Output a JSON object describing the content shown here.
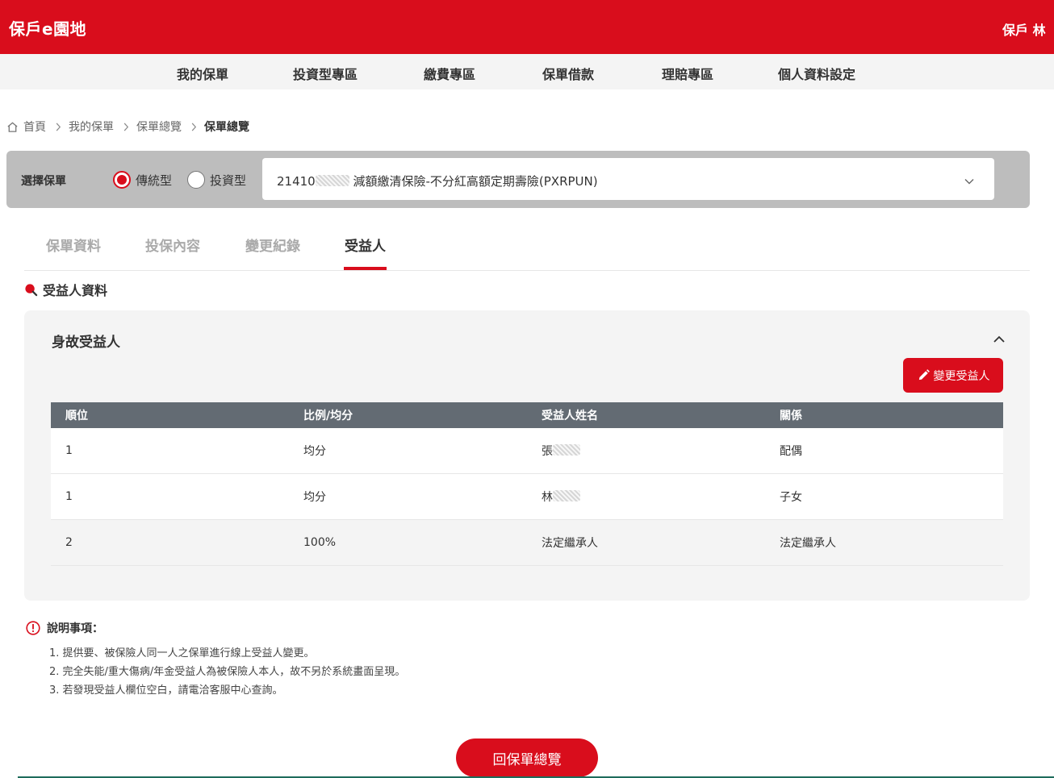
{
  "header": {
    "brand": "保戶e園地",
    "user": "保戶 林"
  },
  "nav": [
    {
      "label": "我的保單"
    },
    {
      "label": "投資型專區"
    },
    {
      "label": "繳費專區"
    },
    {
      "label": "保單借款"
    },
    {
      "label": "理賠專區"
    },
    {
      "label": "個人資料設定"
    }
  ],
  "breadcrumb": {
    "home": "首頁",
    "items": [
      "我的保單",
      "保單總覽"
    ],
    "current": "保單總覽"
  },
  "selector": {
    "label": "選擇保單",
    "options": [
      {
        "label": "傳統型",
        "checked": true
      },
      {
        "label": "投資型",
        "checked": false
      }
    ],
    "policy_prefix": "21410",
    "policy_name": "減額繳清保險-不分紅高額定期壽險(PXRPUN)"
  },
  "tabs": [
    {
      "label": "保單資料",
      "active": false
    },
    {
      "label": "投保內容",
      "active": false
    },
    {
      "label": "變更紀錄",
      "active": false
    },
    {
      "label": "受益人",
      "active": true
    }
  ],
  "section_title": "受益人資料",
  "card": {
    "title": "身故受益人",
    "change_button": "變更受益人",
    "columns": [
      "順位",
      "比例/均分",
      "受益人姓名",
      "關係"
    ],
    "rows": [
      {
        "rank": "1",
        "ratio": "均分",
        "name": "張",
        "relation": "配偶"
      },
      {
        "rank": "1",
        "ratio": "均分",
        "name": "林",
        "relation": "子女"
      },
      {
        "rank": "2",
        "ratio": "100%",
        "name": "法定繼承人",
        "relation": "法定繼承人"
      }
    ]
  },
  "notes": {
    "title": "說明事項：",
    "items": [
      "1. 提供要、被保險人同一人之保單進行線上受益人變更。",
      "2. 完全失能/重大傷病/年金受益人為被保險人本人，故不另於系統畫面呈現。",
      "3. 若發現受益人欄位空白，請電洽客服中心查詢。"
    ]
  },
  "back_button": "回保單總覽",
  "colors": {
    "brand_red": "#d90d1c",
    "table_header": "#636b73",
    "panel_gray": "#bdbdbd"
  },
  "icons": [
    "home-icon",
    "chevron-right-icon",
    "chevron-down-icon",
    "chevron-up-icon",
    "pencil-icon",
    "info-icon",
    "search-dot-icon"
  ]
}
